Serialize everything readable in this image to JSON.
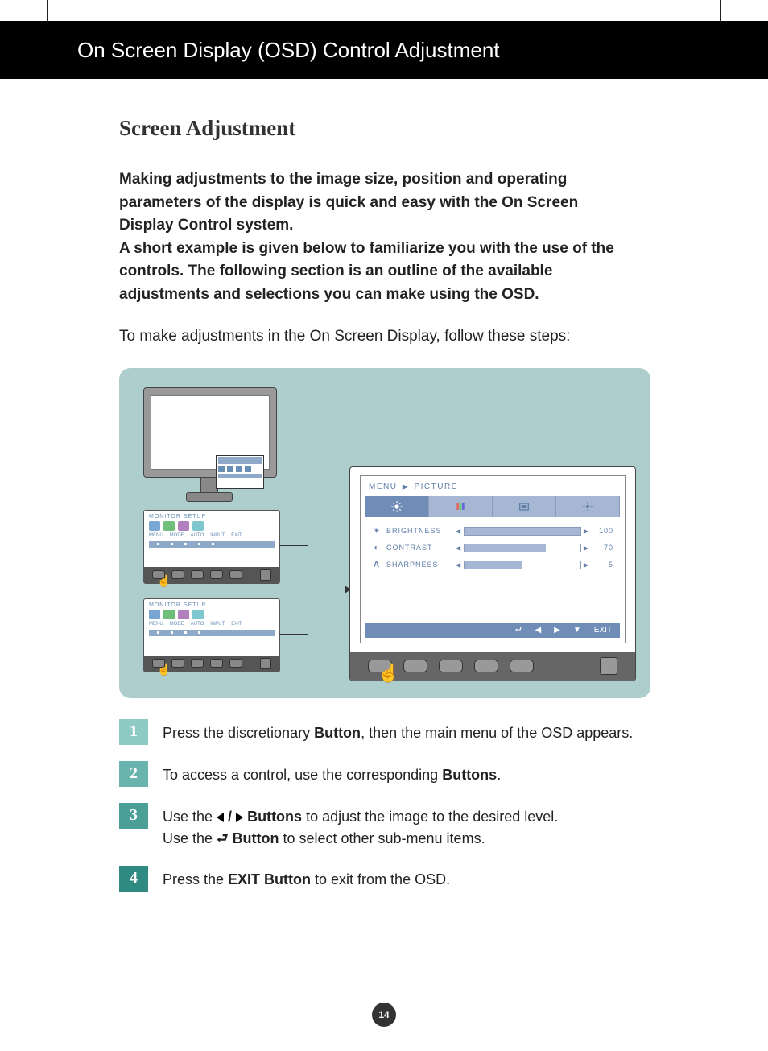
{
  "header": {
    "title": "On Screen Display (OSD) Control Adjustment"
  },
  "section": {
    "title": "Screen Adjustment",
    "intro_bold": "Making adjustments to the image size, position and operating parameters of the display is quick and easy with the On Screen Display Control system.\nA short example is given below to familiarize you with the use of the controls. The following section is an outline of the available adjustments and selections you can make using the OSD.",
    "intro_normal": "To make adjustments in the On Screen Display, follow these steps:"
  },
  "small_osd": {
    "title": "MONITOR SETUP",
    "labels": [
      "MENU",
      "MODE",
      "AUTO",
      "INPUT",
      "EXIT"
    ]
  },
  "big_osd": {
    "breadcrumb_a": "MENU",
    "breadcrumb_b": "PICTURE",
    "rows": [
      {
        "label": "BRIGHTNESS",
        "value": "100",
        "fill": 100
      },
      {
        "label": "CONTRAST",
        "value": "70",
        "fill": 70
      },
      {
        "label": "SHARPNESS",
        "value": "5",
        "fill": 50
      }
    ],
    "nav_exit": "EXIT"
  },
  "steps": {
    "s1": {
      "num": "1",
      "a": "Press the discretionary ",
      "b": "Button",
      "c": ", then the main menu of the OSD appears."
    },
    "s2": {
      "num": "2",
      "a": "To access a control, use the corresponding ",
      "b": "Buttons",
      "c": "."
    },
    "s3": {
      "num": "3",
      "a": "Use the ",
      "b": " Buttons",
      "c": " to adjust the image to the desired level.",
      "d": "Use the ",
      "e": " Button",
      "f": " to select other sub-menu items."
    },
    "s4": {
      "num": "4",
      "a": "Press the ",
      "b": "EXIT Button",
      "c": " to exit from the OSD."
    }
  },
  "page_number": "14"
}
